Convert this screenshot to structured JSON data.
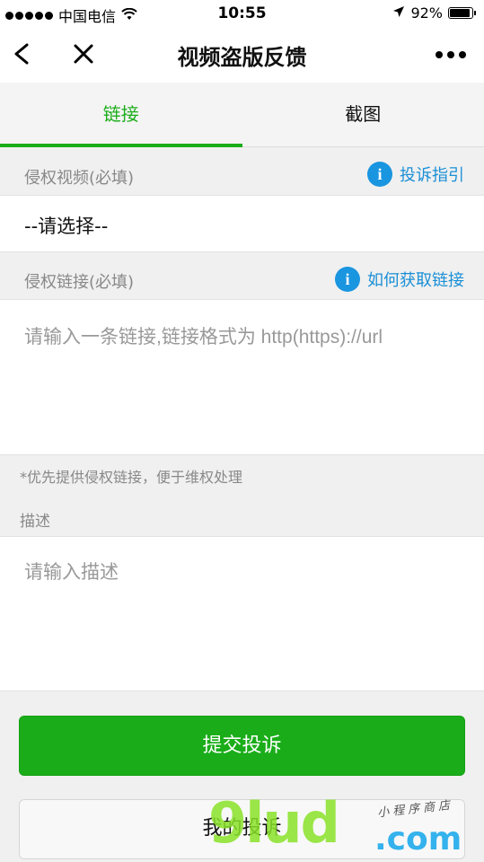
{
  "status_bar": {
    "carrier": "中国电信",
    "time": "10:55",
    "battery": "92%",
    "battery_level": 0.92,
    "icons": [
      "signal-dots-icon",
      "wifi-icon",
      "location-arrow-icon",
      "battery-icon"
    ]
  },
  "nav": {
    "title": "视频盗版反馈",
    "icons": [
      "back-chevron-icon",
      "close-icon",
      "more-dots-icon"
    ]
  },
  "tabs": [
    {
      "label": "链接",
      "active": true
    },
    {
      "label": "截图",
      "active": false
    }
  ],
  "form": {
    "video_label": "侵权视频(必填)",
    "video_hint": "投诉指引",
    "video_select_value": "--请选择--",
    "link_label": "侵权链接(必填)",
    "link_hint": "如何获取链接",
    "link_placeholder": "请输入一条链接,链接格式为 http(https)://url",
    "note": "*优先提供侵权链接，便于维权处理",
    "desc_label": "描述",
    "desc_placeholder": "请输入描述"
  },
  "buttons": {
    "submit": "提交投诉",
    "my_complaints": "我的投诉"
  },
  "watermark": {
    "main": "9lud",
    "domain": ".com",
    "tagline": "小程序商店"
  },
  "colors": {
    "accent_green": "#1aad19",
    "info_blue": "#1a95e0",
    "link_blue": "#1a8fd6"
  }
}
